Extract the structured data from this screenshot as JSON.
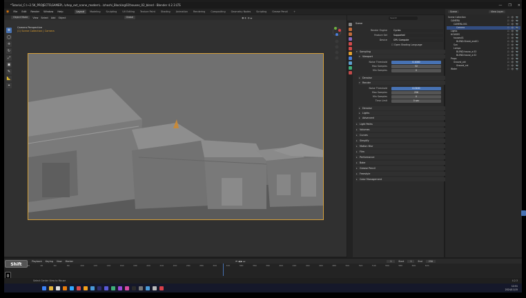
{
  "window": {
    "title": "*Tutorial_C:\\~2.5K_PROJECTS\\GAMER\\..\\shop_ext_scene_modern\\...\\shoshi_Blocking02\\houses_02_blend - Blender 4.2.3 LTS",
    "controls": [
      "—",
      "❐",
      "✕"
    ]
  },
  "menubar": {
    "items": [
      "File",
      "Edit",
      "Render",
      "Window",
      "Help"
    ],
    "workspaces": [
      "Layout",
      "Modeling",
      "Sculpting",
      "UV Editing",
      "Texture Paint",
      "Shading",
      "Animation",
      "Rendering",
      "Compositing",
      "Geometry Nodes",
      "Scripting",
      "Grease Pencil",
      "+"
    ],
    "active_workspace": "Layout"
  },
  "viewport": {
    "header": [
      "Object Mode",
      "View",
      "Select",
      "Add",
      "Object",
      "Global"
    ],
    "camera_label": "Camera Perspective",
    "collection_label": "(1) Scene Collection | Camera",
    "tools": [
      "✥",
      "◯",
      "✛",
      "↻",
      "⤢",
      "▣",
      "✎",
      "📐",
      "⌖"
    ]
  },
  "properties": {
    "scene_label": "Scene",
    "search_placeholder": "Search",
    "fields": [
      {
        "label": "Render Engine",
        "value": "Cycles",
        "dropdown": true
      },
      {
        "label": "Feature Set",
        "value": "Supported",
        "dropdown": true
      },
      {
        "label": "Device",
        "value": "GPU Compute",
        "dropdown": true
      }
    ],
    "checkbox_osl": "Open Shading Language",
    "sampling_label": "Sampling",
    "viewport_label": "Viewport",
    "viewport_fields": [
      {
        "label": "Noise Threshold",
        "value": "0.1000",
        "highlight": true
      },
      {
        "label": "Max Samples",
        "value": "32"
      },
      {
        "label": "Min Samples",
        "value": "0"
      }
    ],
    "denoise_label": "Denoise",
    "render_label": "Render",
    "render_fields": [
      {
        "label": "Noise Threshold",
        "value": "0.0100",
        "highlight": true
      },
      {
        "label": "Max Samples",
        "value": "256"
      },
      {
        "label": "Min Samples",
        "value": "0"
      },
      {
        "label": "Time Limit",
        "value": "0 sec"
      }
    ],
    "sub_sections": [
      "Denoise",
      "Lights",
      "Advanced"
    ],
    "sections": [
      "Light Paths",
      "Volumes",
      "Curves",
      "Simplify",
      "Motion Blur",
      "Film",
      "Performance",
      "Bake",
      "Grease Pencil",
      "Freestyle",
      "Color Management"
    ]
  },
  "outliner": {
    "header_label": "Scene",
    "view_layer": "View Layer",
    "rows": [
      {
        "name": "Scene Collection",
        "indent": 0,
        "selected": false
      },
      {
        "name": "CAMERA",
        "indent": 1,
        "selected": false
      },
      {
        "name": "CAMERA.001",
        "indent": 2,
        "selected": false
      },
      {
        "name": "Camera",
        "indent": 3,
        "selected": true
      },
      {
        "name": "Lights",
        "indent": 1,
        "selected": false
      },
      {
        "name": "HOUSES",
        "indent": 1,
        "selected": false
      },
      {
        "name": "houses01",
        "indent": 2,
        "selected": false
      },
      {
        "name": "BLEND.Street_end01",
        "indent": 3,
        "selected": false
      },
      {
        "name": "Sun",
        "indent": 2,
        "selected": false
      },
      {
        "name": "Lamps",
        "indent": 2,
        "selected": false
      },
      {
        "name": "BLEND.house_a.03",
        "indent": 3,
        "selected": false
      },
      {
        "name": "BLEND.house_a.02",
        "indent": 3,
        "selected": false
      },
      {
        "name": "Props",
        "indent": 1,
        "selected": false
      },
      {
        "name": "Ground_old",
        "indent": 2,
        "selected": false
      },
      {
        "name": "Ground_col",
        "indent": 3,
        "selected": false
      },
      {
        "name": "Water",
        "indent": 1,
        "selected": false
      }
    ]
  },
  "timeline": {
    "menus": [
      "Playback",
      "Keying",
      "View",
      "Marker"
    ],
    "ticks": [
      "0",
      "20",
      "40",
      "60",
      "80",
      "100",
      "120",
      "140",
      "160",
      "180",
      "200",
      "220",
      "240",
      "260",
      "280",
      "300",
      "320",
      "340",
      "360",
      "380",
      "400",
      "420",
      "440",
      "460",
      "480",
      "500",
      "520",
      "540",
      "560",
      "580",
      "600",
      "620"
    ],
    "current_frame": "1",
    "start_label": "Start",
    "start_value": "1",
    "end_label": "End",
    "end_value": "250"
  },
  "keyboard_overlay": {
    "shift": "Shift",
    "key_a": "0",
    "key_b": "n"
  },
  "statusbar": {
    "text": "Select    Center View to Mouse",
    "version": "4.2.3"
  },
  "taskbar": {
    "time": "12:51",
    "date": "2024/11/15"
  },
  "colors": {
    "accent": "#4772b3",
    "camera_frame": "#d7a23b",
    "panel_bg": "#2b2b2b"
  }
}
